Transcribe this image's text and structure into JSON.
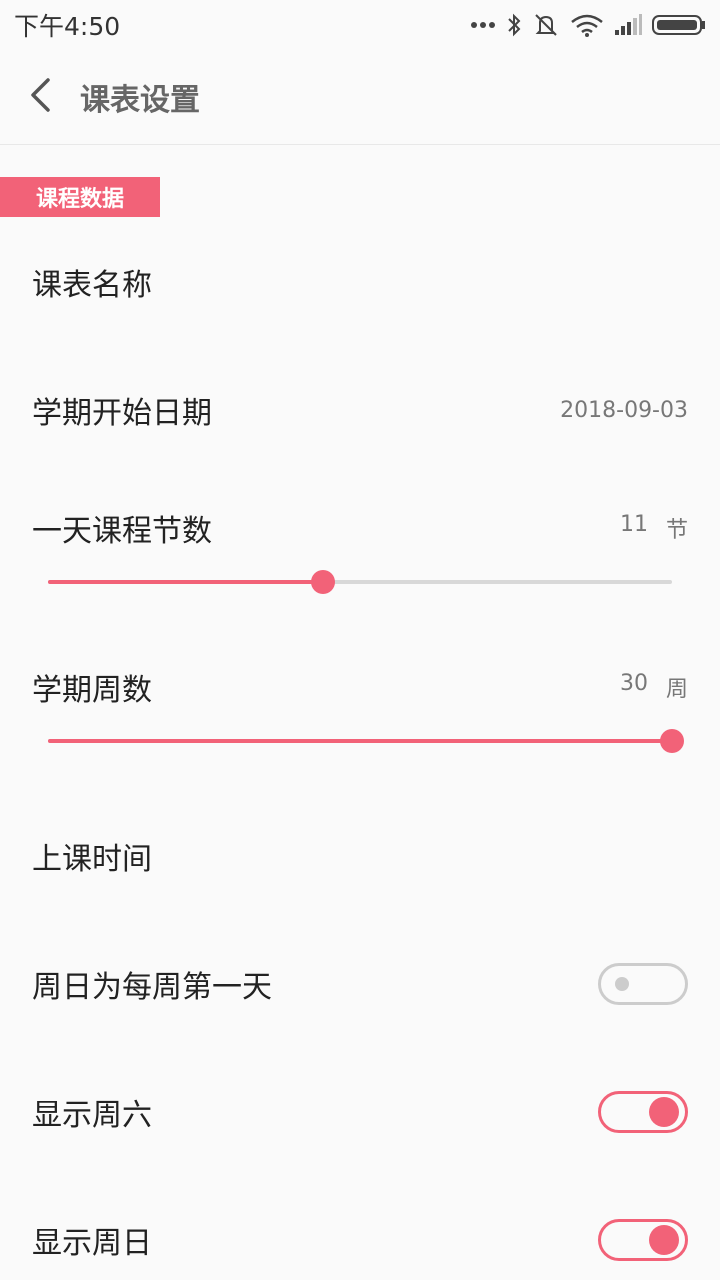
{
  "status_bar": {
    "time": "下午4:50",
    "icons": [
      "more-dots-icon",
      "bluetooth-icon",
      "mute-icon",
      "wifi-icon",
      "signal-icon",
      "battery-icon"
    ]
  },
  "header": {
    "back_icon": "chevron-left-icon",
    "title": "课表设置"
  },
  "section": {
    "tag": "课程数据"
  },
  "settings": {
    "schedule_name": {
      "label": "课表名称"
    },
    "start_date": {
      "label": "学期开始日期",
      "value": "2018-09-03"
    },
    "lessons_per_day": {
      "label": "一天课程节数",
      "value": "11",
      "unit": "节",
      "slider_fraction": 0.44
    },
    "weeks": {
      "label": "学期周数",
      "value": "30",
      "unit": "周",
      "slider_fraction": 1.0
    },
    "class_time": {
      "label": "上课时间"
    },
    "sunday_first": {
      "label": "周日为每周第一天",
      "enabled": false
    },
    "show_saturday": {
      "label": "显示周六",
      "enabled": true
    },
    "show_sunday": {
      "label": "显示周日",
      "enabled": true
    }
  },
  "colors": {
    "accent": "#f26278",
    "track": "#d8d8d8",
    "toggle_off": "#cccccc"
  }
}
